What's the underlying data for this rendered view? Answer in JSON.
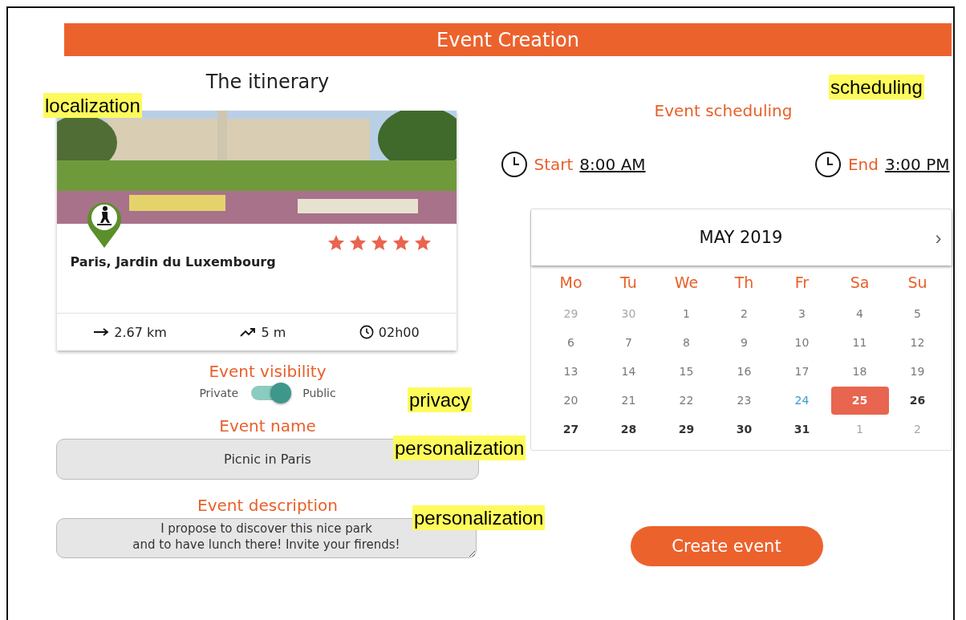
{
  "header": {
    "title": "Event Creation"
  },
  "itinerary": {
    "title": "The itinerary",
    "place": "Paris, Jardin du Luxembourg",
    "stars": 5,
    "stats": [
      {
        "kind": "distance",
        "value": "2.67 km"
      },
      {
        "kind": "elevation",
        "value": "5 m"
      },
      {
        "kind": "duration",
        "value": "02h00"
      }
    ]
  },
  "visibility": {
    "title": "Event visibility",
    "off_label": "Private",
    "on_label": "Public",
    "on": true
  },
  "name": {
    "label": "Event name",
    "value": "Picnic in Paris"
  },
  "description": {
    "label": "Event description",
    "value": "I propose to discover this nice park\nand to have lunch there! Invite your firends!"
  },
  "scheduling": {
    "title": "Event scheduling",
    "start_label": "Start",
    "start": "8:00 AM",
    "end_label": "End",
    "end": "3:00 PM"
  },
  "calendar": {
    "month": "MAY 2019",
    "next": "›",
    "weekdays": [
      "Mo",
      "Tu",
      "We",
      "Th",
      "Fr",
      "Sa",
      "Su"
    ],
    "weeks": [
      [
        {
          "day": "29",
          "kind": "other",
          "selected": false
        },
        {
          "day": "30",
          "kind": "other",
          "selected": false
        },
        {
          "day": "1",
          "kind": "past",
          "selected": false
        },
        {
          "day": "2",
          "kind": "past",
          "selected": false
        },
        {
          "day": "3",
          "kind": "past",
          "selected": false
        },
        {
          "day": "4",
          "kind": "past",
          "selected": false
        },
        {
          "day": "5",
          "kind": "past",
          "selected": false
        }
      ],
      [
        {
          "day": "6",
          "kind": "past",
          "selected": false
        },
        {
          "day": "7",
          "kind": "past",
          "selected": false
        },
        {
          "day": "8",
          "kind": "past",
          "selected": false
        },
        {
          "day": "9",
          "kind": "past",
          "selected": false
        },
        {
          "day": "10",
          "kind": "past",
          "selected": false
        },
        {
          "day": "11",
          "kind": "past",
          "selected": false
        },
        {
          "day": "12",
          "kind": "past",
          "selected": false
        }
      ],
      [
        {
          "day": "13",
          "kind": "past",
          "selected": false
        },
        {
          "day": "14",
          "kind": "past",
          "selected": false
        },
        {
          "day": "15",
          "kind": "past",
          "selected": false
        },
        {
          "day": "16",
          "kind": "past",
          "selected": false
        },
        {
          "day": "17",
          "kind": "past",
          "selected": false
        },
        {
          "day": "18",
          "kind": "past",
          "selected": false
        },
        {
          "day": "19",
          "kind": "past",
          "selected": false
        }
      ],
      [
        {
          "day": "20",
          "kind": "past",
          "selected": false
        },
        {
          "day": "21",
          "kind": "past",
          "selected": false
        },
        {
          "day": "22",
          "kind": "past",
          "selected": false
        },
        {
          "day": "23",
          "kind": "past",
          "selected": false
        },
        {
          "day": "24",
          "kind": "today",
          "selected": false
        },
        {
          "day": "25",
          "kind": "future",
          "selected": true
        },
        {
          "day": "26",
          "kind": "future",
          "selected": false
        }
      ],
      [
        {
          "day": "27",
          "kind": "future",
          "selected": false
        },
        {
          "day": "28",
          "kind": "future",
          "selected": false
        },
        {
          "day": "29",
          "kind": "future",
          "selected": false
        },
        {
          "day": "30",
          "kind": "future",
          "selected": false
        },
        {
          "day": "31",
          "kind": "future",
          "selected": false
        },
        {
          "day": "1",
          "kind": "other",
          "selected": false
        },
        {
          "day": "2",
          "kind": "other",
          "selected": false
        }
      ]
    ]
  },
  "create_button": "Create event",
  "annotations": [
    "localization",
    "scheduling",
    "privacy",
    "personalization",
    "personalization"
  ]
}
